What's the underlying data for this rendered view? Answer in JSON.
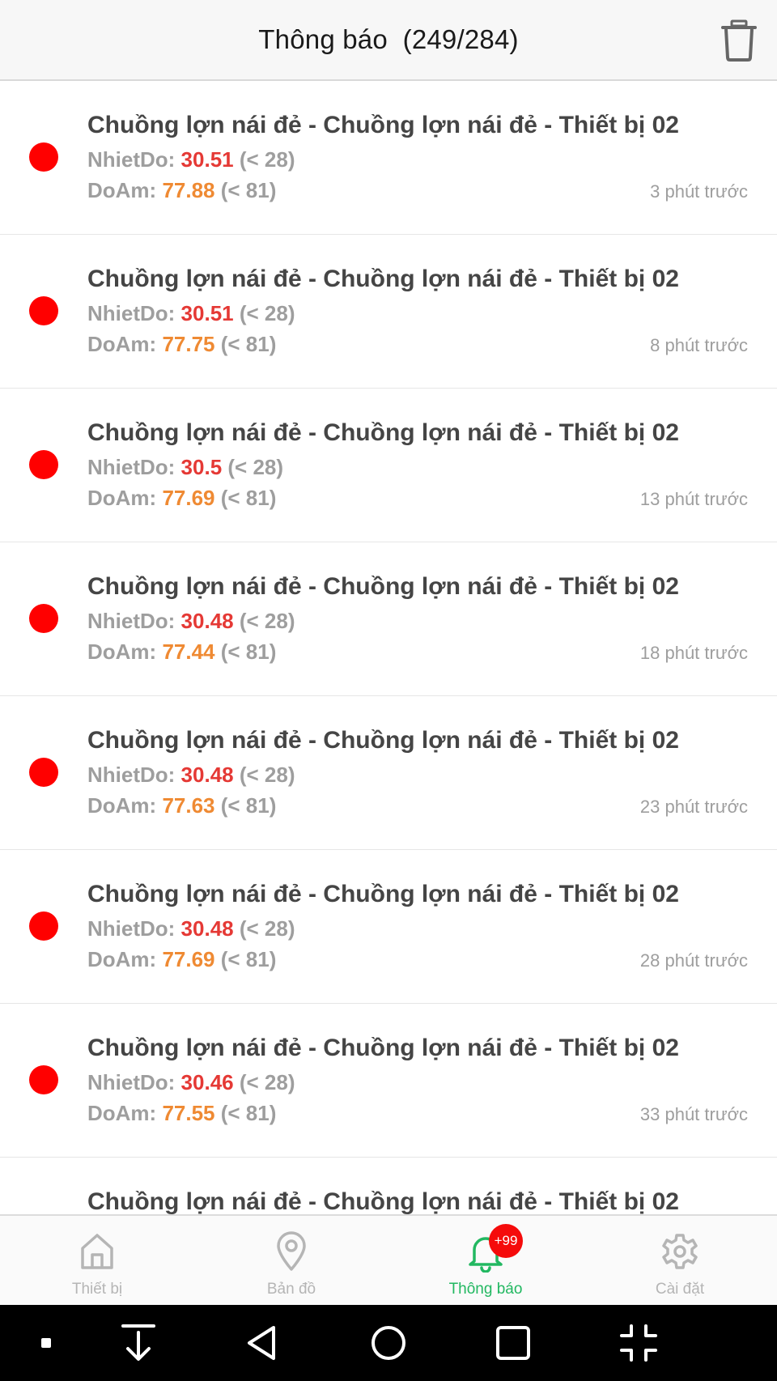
{
  "header": {
    "title": "Thông báo  (249/284)",
    "trash_icon": "trash-icon"
  },
  "colors": {
    "dot": "#ff0000",
    "temp_value": "#e53935",
    "humidity_value": "#ef8a33",
    "active_tab": "#22b861",
    "badge": "#f50b0b"
  },
  "notifications": [
    {
      "title": "Chuồng lợn nái đẻ - Chuồng lợn nái đẻ - Thiết bị 02",
      "temp_label": "NhietDo: ",
      "temp_value": "30.51",
      "temp_limit": " (< 28)",
      "hum_label": "DoAm: ",
      "hum_value": "77.88",
      "hum_limit": " (< 81)",
      "time": "3 phút trước"
    },
    {
      "title": "Chuồng lợn nái đẻ - Chuồng lợn nái đẻ - Thiết bị 02",
      "temp_label": "NhietDo: ",
      "temp_value": "30.51",
      "temp_limit": " (< 28)",
      "hum_label": "DoAm: ",
      "hum_value": "77.75",
      "hum_limit": " (< 81)",
      "time": "8 phút trước"
    },
    {
      "title": "Chuồng lợn nái đẻ - Chuồng lợn nái đẻ - Thiết bị 02",
      "temp_label": "NhietDo: ",
      "temp_value": "30.5",
      "temp_limit": " (< 28)",
      "hum_label": "DoAm: ",
      "hum_value": "77.69",
      "hum_limit": " (< 81)",
      "time": "13 phút trước"
    },
    {
      "title": "Chuồng lợn nái đẻ - Chuồng lợn nái đẻ - Thiết bị 02",
      "temp_label": "NhietDo: ",
      "temp_value": "30.48",
      "temp_limit": " (< 28)",
      "hum_label": "DoAm: ",
      "hum_value": "77.44",
      "hum_limit": " (< 81)",
      "time": "18 phút trước"
    },
    {
      "title": "Chuồng lợn nái đẻ - Chuồng lợn nái đẻ - Thiết bị 02",
      "temp_label": "NhietDo: ",
      "temp_value": "30.48",
      "temp_limit": " (< 28)",
      "hum_label": "DoAm: ",
      "hum_value": "77.63",
      "hum_limit": " (< 81)",
      "time": "23 phút trước"
    },
    {
      "title": "Chuồng lợn nái đẻ - Chuồng lợn nái đẻ - Thiết bị 02",
      "temp_label": "NhietDo: ",
      "temp_value": "30.48",
      "temp_limit": " (< 28)",
      "hum_label": "DoAm: ",
      "hum_value": "77.69",
      "hum_limit": " (< 81)",
      "time": "28 phút trước"
    },
    {
      "title": "Chuồng lợn nái đẻ - Chuồng lợn nái đẻ - Thiết bị 02",
      "temp_label": "NhietDo: ",
      "temp_value": "30.46",
      "temp_limit": " (< 28)",
      "hum_label": "DoAm: ",
      "hum_value": "77.55",
      "hum_limit": " (< 81)",
      "time": "33 phút trước"
    },
    {
      "title": "Chuồng lợn nái đẻ - Chuồng lợn nái đẻ - Thiết bị 02"
    }
  ],
  "tabs": [
    {
      "label": "Thiết bị",
      "icon": "home-icon",
      "active": false
    },
    {
      "label": "Bản đồ",
      "icon": "map-pin-icon",
      "active": false
    },
    {
      "label": "Thông báo",
      "icon": "bell-icon",
      "active": true,
      "badge": "+99"
    },
    {
      "label": "Cài đặt",
      "icon": "gear-icon",
      "active": false
    }
  ],
  "system_nav": [
    "square-dot-icon",
    "download-arrow-icon",
    "back-triangle-icon",
    "home-circle-icon",
    "recents-square-icon",
    "collapse-corners-icon"
  ]
}
